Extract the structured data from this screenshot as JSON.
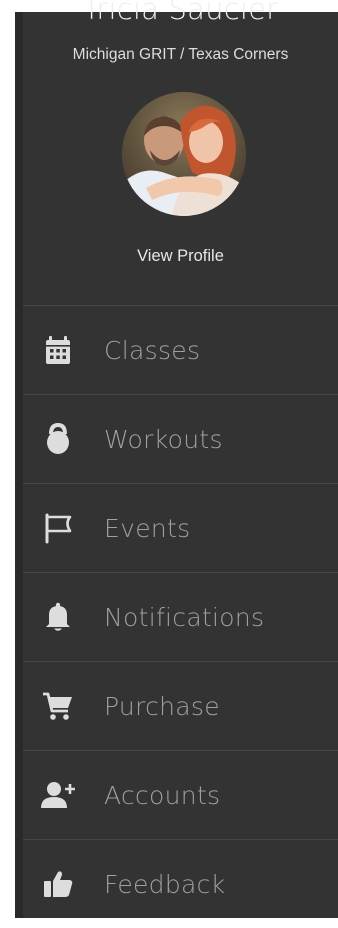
{
  "profile": {
    "name": "Tricia Saucier",
    "gym": "Michigan GRIT / Texas Corners",
    "view_profile": "View Profile"
  },
  "menu": {
    "items": [
      {
        "label": "Classes",
        "icon": "calendar-icon"
      },
      {
        "label": "Workouts",
        "icon": "kettlebell-icon"
      },
      {
        "label": "Events",
        "icon": "flag-icon"
      },
      {
        "label": "Notifications",
        "icon": "bell-icon"
      },
      {
        "label": "Purchase",
        "icon": "cart-icon"
      },
      {
        "label": "Accounts",
        "icon": "add-user-icon"
      },
      {
        "label": "Feedback",
        "icon": "thumbs-up-icon"
      }
    ]
  },
  "colors": {
    "drawer_bg": "#333333",
    "divider": "#464646",
    "icon": "#dddddd",
    "menu_text": "#a0a0a0",
    "name_text": "#eeeeee"
  }
}
